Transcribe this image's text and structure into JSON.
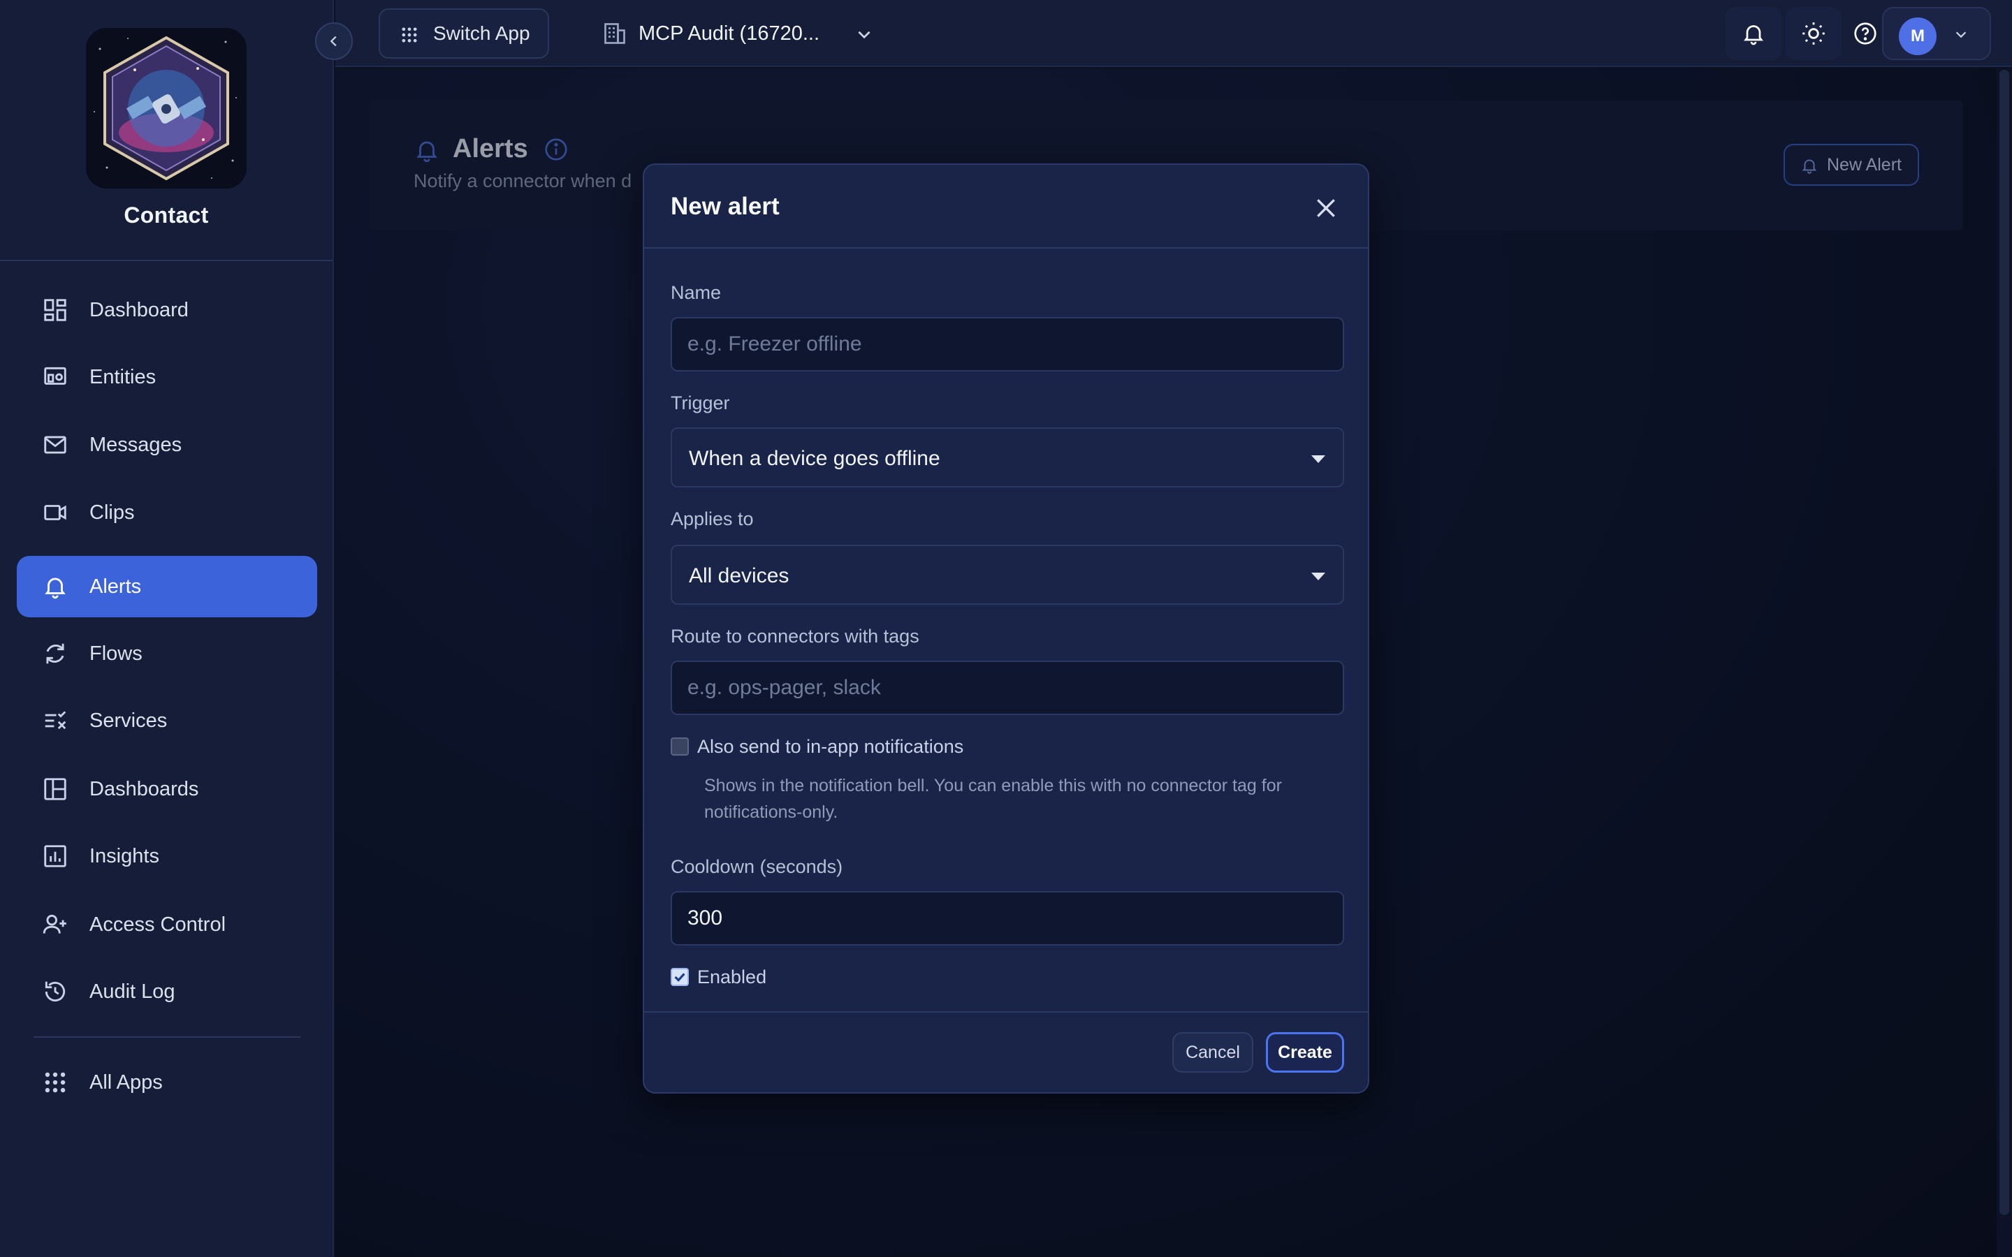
{
  "app": {
    "name": "Contact",
    "switch_app_label": "Switch App",
    "org_selector_label": "MCP Audit (16720..."
  },
  "colors": {
    "accent": "#3d63db",
    "sidebar_bg": "#151d38",
    "modal_bg": "#1a2448",
    "avatar_bg": "#4f6fe6"
  },
  "user": {
    "initial": "M"
  },
  "sidebar": {
    "items": [
      {
        "label": "Dashboard",
        "icon": "dashboard-icon",
        "active": false
      },
      {
        "label": "Entities",
        "icon": "entities-icon",
        "active": false
      },
      {
        "label": "Messages",
        "icon": "mail-icon",
        "active": false
      },
      {
        "label": "Clips",
        "icon": "video-icon",
        "active": false
      },
      {
        "label": "Alerts",
        "icon": "bell-icon",
        "active": true
      },
      {
        "label": "Flows",
        "icon": "refresh-icon",
        "active": false
      },
      {
        "label": "Services",
        "icon": "services-icon",
        "active": false
      },
      {
        "label": "Dashboards",
        "icon": "layout-icon",
        "active": false
      },
      {
        "label": "Insights",
        "icon": "chart-icon",
        "active": false
      },
      {
        "label": "Access Control",
        "icon": "users-icon",
        "active": false
      },
      {
        "label": "Audit Log",
        "icon": "history-icon",
        "active": false
      }
    ],
    "footer_item": {
      "label": "All Apps",
      "icon": "grid-icon"
    }
  },
  "page": {
    "title": "Alerts",
    "subtitle": "Notify a connector when d",
    "new_alert_label": "New Alert"
  },
  "modal": {
    "title": "New alert",
    "name": {
      "label": "Name",
      "placeholder": "e.g. Freezer offline",
      "value": ""
    },
    "trigger": {
      "label": "Trigger",
      "value": "When a device goes offline"
    },
    "applies_to": {
      "label": "Applies to",
      "value": "All devices"
    },
    "tags": {
      "label": "Route to connectors with tags",
      "placeholder": "e.g. ops-pager, slack",
      "value": ""
    },
    "in_app": {
      "label": "Also send to in-app notifications",
      "checked": false,
      "helper": "Shows in the notification bell. You can enable this with no connector tag for notifications-only."
    },
    "cooldown": {
      "label": "Cooldown (seconds)",
      "value": "300"
    },
    "enabled": {
      "label": "Enabled",
      "checked": true
    },
    "cancel_label": "Cancel",
    "create_label": "Create"
  }
}
